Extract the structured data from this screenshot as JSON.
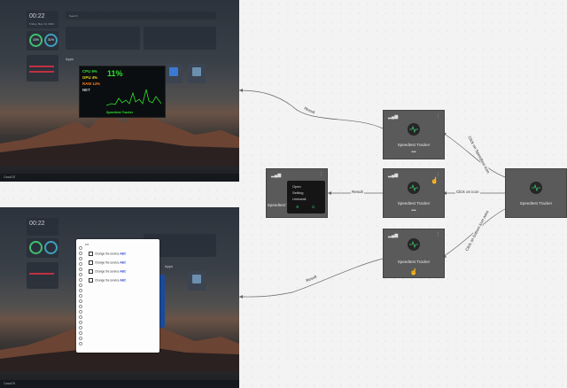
{
  "top_screenshot": {
    "clock": "00:22",
    "date": "Friday, May 10, 2024",
    "search_placeholder": "Search",
    "gauge_labels": [
      "CPU",
      "RAM"
    ],
    "gauge_values": [
      "10%",
      "31%"
    ],
    "apps_heading": "Apps",
    "os_name": "CasaOS",
    "monitor": {
      "cpu": "CPU 9%",
      "gpu": "GPU 4%",
      "ram": "RAM 14%",
      "net": "NET",
      "big_value": "11%",
      "footer": "Speedtest Tracker"
    }
  },
  "bottom_screenshot": {
    "clock": "00:22",
    "apps_heading": "Apps",
    "os_name": "CasaOS",
    "notebook_items": [
      {
        "text": "Change the service",
        "accent": "ABC"
      },
      {
        "text": "Change the service",
        "accent": "ABC"
      },
      {
        "text": "Change the service",
        "accent": "ABC"
      },
      {
        "text": "Change the service",
        "accent": "ABC"
      }
    ]
  },
  "nodes": {
    "left": {
      "label": "Speedtest Tracker"
    },
    "top": {
      "label": "Speedtest Tracker"
    },
    "middle": {
      "label": "Speedtest Tracker"
    },
    "bottom": {
      "label": "Speedtest Tracker"
    },
    "right": {
      "label": "Speedtest Tracker"
    }
  },
  "context_menu": {
    "items": [
      "Open",
      "Setting",
      "Uninstall"
    ]
  },
  "edges": {
    "top_to_shot": "Result",
    "left_to_menu": "Result",
    "bottom_to_shot": "Result",
    "right_to_top": "Click on Speedtest icon",
    "right_to_middle": "Click on icon",
    "right_to_bottom": "Click on bottom icon area"
  },
  "colors": {
    "node_bg": "#5a5a5a",
    "accent_green": "#3fbf6f",
    "monitor_green": "#2ee02e",
    "monitor_yellow": "#e8d320",
    "monitor_orange": "#ff7a1a"
  }
}
